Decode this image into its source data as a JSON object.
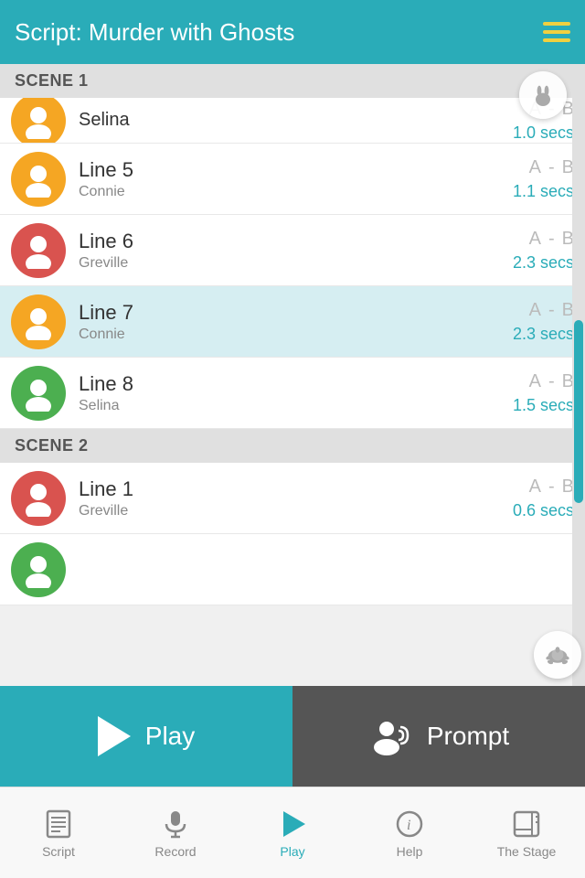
{
  "header": {
    "title": "Script:  Murder with Ghosts",
    "menu_icon": "hamburger-icon"
  },
  "scenes": [
    {
      "label": "SCENE 1",
      "lines": [
        {
          "number": "Line 5",
          "character": "Connie",
          "avatar_color": "orange",
          "avatar_type": "female",
          "secs": "1.1 secs",
          "selected": false
        },
        {
          "number": "Line 6",
          "character": "Greville",
          "avatar_color": "red",
          "avatar_type": "male",
          "secs": "2.3 secs",
          "selected": false
        },
        {
          "number": "Line 7",
          "character": "Connie",
          "avatar_color": "orange",
          "avatar_type": "female",
          "secs": "2.3 secs",
          "selected": true
        },
        {
          "number": "Line 8",
          "character": "Selina",
          "avatar_color": "green",
          "avatar_type": "female2",
          "secs": "1.5 secs",
          "selected": false
        }
      ]
    },
    {
      "label": "SCENE 2",
      "lines": [
        {
          "number": "Line 1",
          "character": "Greville",
          "avatar_color": "red",
          "avatar_type": "male",
          "secs": "0.6 secs",
          "selected": false
        }
      ]
    }
  ],
  "buttons": {
    "play_label": "Play",
    "prompt_label": "Prompt"
  },
  "tabs": [
    {
      "label": "Script",
      "icon": "script-icon",
      "active": false
    },
    {
      "label": "Record",
      "icon": "mic-icon",
      "active": false
    },
    {
      "label": "Play",
      "icon": "play-icon",
      "active": true
    },
    {
      "label": "Help",
      "icon": "info-icon",
      "active": false
    },
    {
      "label": "The Stage",
      "icon": "stage-icon",
      "active": false
    }
  ],
  "colors": {
    "teal": "#2aacb8",
    "orange": "#f5a623",
    "red": "#d9534f",
    "green": "#4caf50",
    "selected_bg": "#d6eef2",
    "dark_btn": "#555555"
  }
}
